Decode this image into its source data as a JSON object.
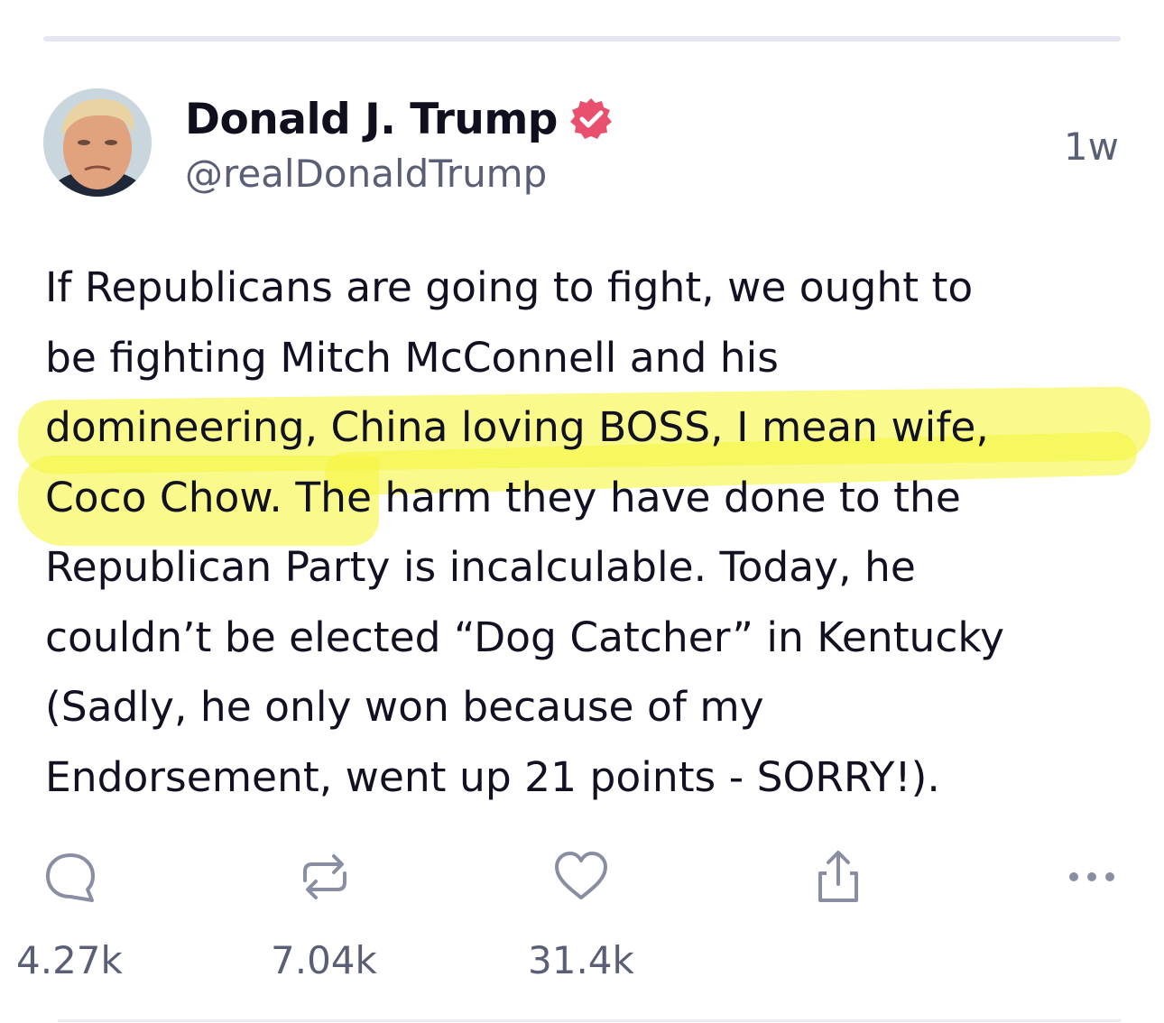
{
  "post": {
    "display_name": "Donald J. Trump",
    "handle": "@realDonaldTrump",
    "timestamp": "1w",
    "verified_icon": "verified-badge-icon",
    "text_lines": [
      "If Republicans are going to fight, we ought to",
      "be fighting Mitch McConnell and his",
      "domineering, China loving BOSS, I mean wife,",
      "Coco Chow. The harm they have done to the",
      "Republican Party is incalculable. Today, he",
      "couldn’t be elected “Dog Catcher” in Kentucky",
      "(Sadly, he only won because of my",
      "Endorsement, went up 21 points - SORRY!)."
    ]
  },
  "actions": {
    "reply": {
      "icon": "reply-icon",
      "count": "4.27k"
    },
    "repost": {
      "icon": "repost-icon",
      "count": "7.04k"
    },
    "like": {
      "icon": "heart-icon",
      "count": "31.4k"
    },
    "share": {
      "icon": "share-icon"
    },
    "more": {
      "icon": "more-icon"
    }
  },
  "colors": {
    "verified_badge": "#e8506e",
    "highlight": "#f6f646",
    "muted_text": "#5a5f75",
    "icon_color": "#8a8ea3"
  }
}
